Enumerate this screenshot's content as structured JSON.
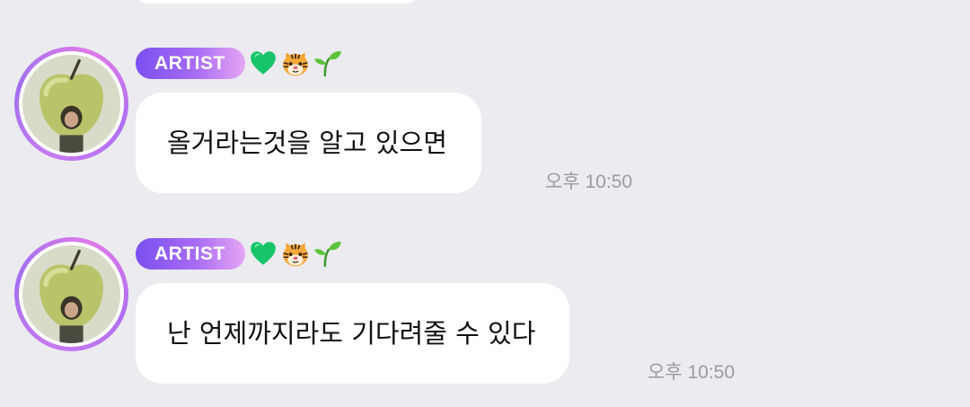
{
  "messages": [
    {
      "sender_badge": "ARTIST",
      "emoji": [
        "green-heart",
        "tiger-face",
        "seedling"
      ],
      "text": "올거라는것을 알고 있으면",
      "time": "오후 10:50"
    },
    {
      "sender_badge": "ARTIST",
      "emoji": [
        "green-heart",
        "tiger-face",
        "seedling"
      ],
      "text": "난 언제까지라도 기다려줄 수 있다",
      "time": "오후 10:50"
    }
  ],
  "colors": {
    "background": "#ebebf0",
    "bubble": "#ffffff",
    "badge_start": "#7b4ff0",
    "badge_end": "#e6a6f4",
    "time_text": "#9a9aa2",
    "message_text": "#111111"
  }
}
